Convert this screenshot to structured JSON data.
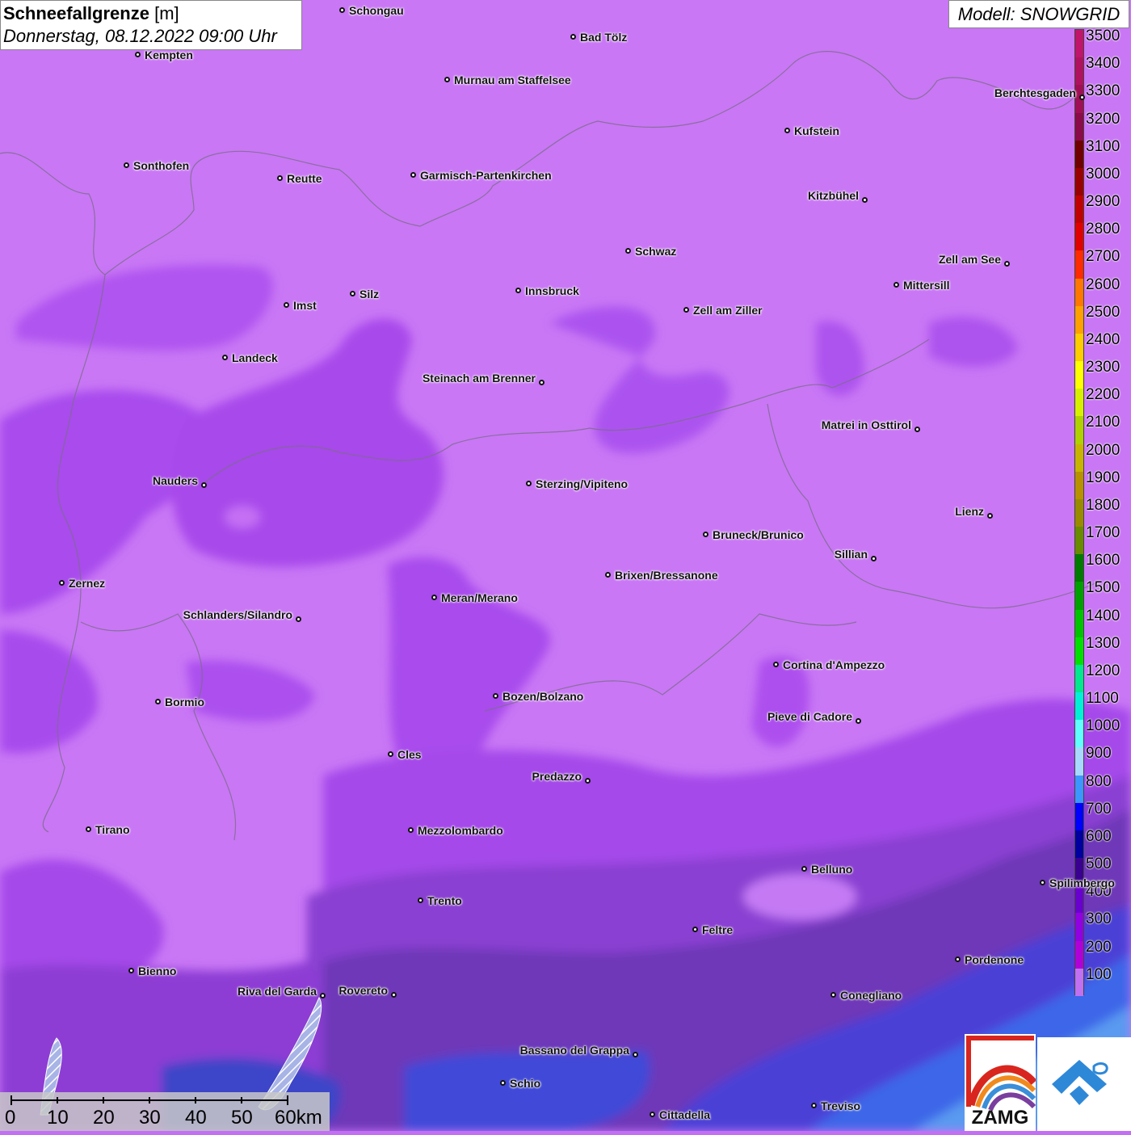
{
  "header": {
    "title_bold": "Schneefallgrenze",
    "title_unit": "[m]",
    "datetime": "Donnerstag, 08.12.2022 09:00 Uhr",
    "model": "Modell: SNOWGRID"
  },
  "legend": {
    "levels": [
      "3500",
      "3400",
      "3300",
      "3200",
      "3100",
      "3000",
      "2900",
      "2800",
      "2700",
      "2600",
      "2500",
      "2400",
      "2300",
      "2200",
      "2100",
      "2000",
      "1900",
      "1800",
      "1700",
      "1600",
      "1500",
      "1400",
      "1300",
      "1200",
      "1100",
      "1000",
      "900",
      "800",
      "700",
      "600",
      "500",
      "400",
      "300",
      "200",
      "100"
    ],
    "colors": [
      "#c0156b",
      "#b0125f",
      "#a00f55",
      "#8a0a4a",
      "#700000",
      "#990000",
      "#c00000",
      "#e00000",
      "#ff2a00",
      "#ff7700",
      "#ffa000",
      "#ffcc00",
      "#ffff00",
      "#d8f000",
      "#b0d000",
      "#c8b400",
      "#b89000",
      "#9a8a00",
      "#6a8a00",
      "#007a00",
      "#00a000",
      "#00c400",
      "#00e000",
      "#00e890",
      "#00f0d8",
      "#60ffff",
      "#a8d8ff",
      "#3c96ff",
      "#0000ff",
      "#0000a0",
      "#3a0090",
      "#6a00d0",
      "#9000e0",
      "#b000d8",
      "#c070f0"
    ]
  },
  "cities": [
    {
      "name": "Schongau"
    },
    {
      "name": "Bad Tölz"
    },
    {
      "name": "Kempten"
    },
    {
      "name": "Murnau am Staffelsee"
    },
    {
      "name": "Berchtesgaden"
    },
    {
      "name": "Kufstein"
    },
    {
      "name": "Sonthofen"
    },
    {
      "name": "Reutte"
    },
    {
      "name": "Garmisch-Partenkirchen"
    },
    {
      "name": "Kitzbühel"
    },
    {
      "name": "Schwaz"
    },
    {
      "name": "Zell am See"
    },
    {
      "name": "Mittersill"
    },
    {
      "name": "Innsbruck"
    },
    {
      "name": "Silz"
    },
    {
      "name": "Imst"
    },
    {
      "name": "Zell am Ziller"
    },
    {
      "name": "Landeck"
    },
    {
      "name": "Steinach am Brenner"
    },
    {
      "name": "Matrei in Osttirol"
    },
    {
      "name": "Nauders"
    },
    {
      "name": "Sterzing/Vipiteno"
    },
    {
      "name": "Lienz"
    },
    {
      "name": "Bruneck/Brunico"
    },
    {
      "name": "Sillian"
    },
    {
      "name": "Zernez"
    },
    {
      "name": "Brixen/Bressanone"
    },
    {
      "name": "Meran/Merano"
    },
    {
      "name": "Schlanders/Silandro"
    },
    {
      "name": "Cortina d'Ampezzo"
    },
    {
      "name": "Bozen/Bolzano"
    },
    {
      "name": "Bormio"
    },
    {
      "name": "Pieve di Cadore"
    },
    {
      "name": "Cles"
    },
    {
      "name": "Predazzo"
    },
    {
      "name": "Tirano"
    },
    {
      "name": "Mezzolombardo"
    },
    {
      "name": "Belluno"
    },
    {
      "name": "Spilimbergo"
    },
    {
      "name": "Trento"
    },
    {
      "name": "Feltre"
    },
    {
      "name": "Pordenone"
    },
    {
      "name": "Bienno"
    },
    {
      "name": "Riva del Garda"
    },
    {
      "name": "Rovereto"
    },
    {
      "name": "Conegliano"
    },
    {
      "name": "Bassano del Grappa"
    },
    {
      "name": "Schio"
    },
    {
      "name": "Treviso"
    },
    {
      "name": "Cittadella"
    }
  ],
  "scale": {
    "labels": [
      "0",
      "10",
      "20",
      "30",
      "40",
      "50",
      "60km"
    ]
  },
  "logo": {
    "text": "ZAMG"
  }
}
